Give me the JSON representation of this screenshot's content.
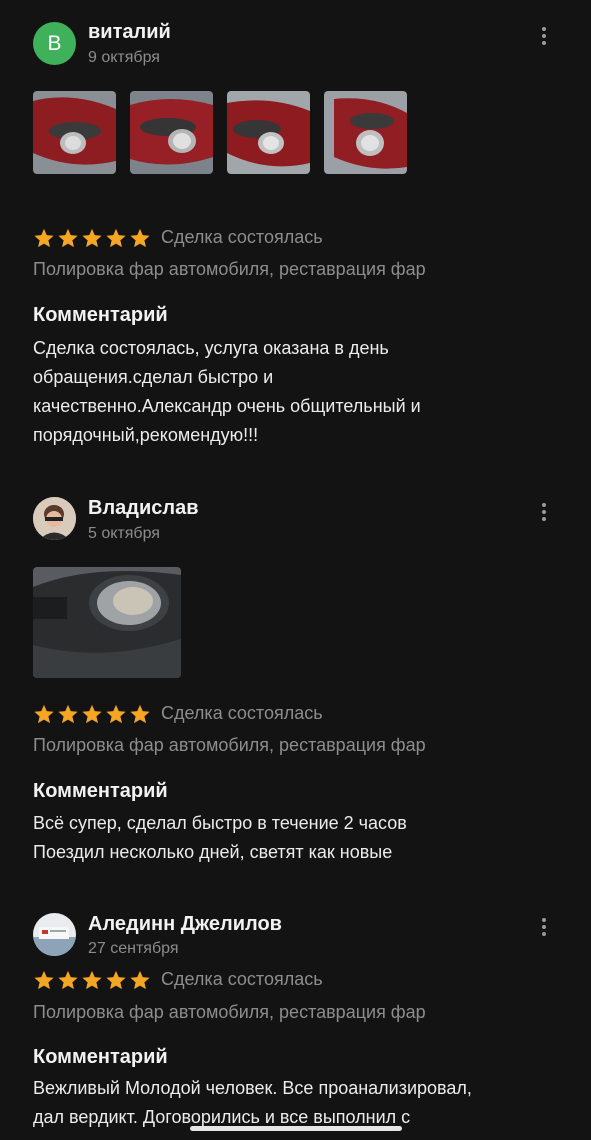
{
  "reviews": [
    {
      "avatar_letter": "В",
      "author": "виталий",
      "date": "9 октября",
      "status": "Сделка состоялась",
      "service": "Полировка фар автомобиля, реставрация фар",
      "comment_title": "Комментарий",
      "comment": "Сделка состоялась, услуга оказана в день\nобращения.сделал быстро и\nкачественно.Александр очень общительный и\nпорядочный,рекомендую!!!",
      "rating": 5,
      "photos": 4
    },
    {
      "author": "Владислав",
      "date": "5 октября",
      "status": "Сделка состоялась",
      "service": "Полировка фар автомобиля, реставрация фар",
      "comment_title": "Комментарий",
      "comment": "Всё супер, сделал быстро в течение 2 часов\nПоездил несколько дней, светят как новые",
      "rating": 5,
      "photos": 1
    },
    {
      "author": "Алединн Джелилов",
      "date": "27 сентября",
      "status": "Сделка состоялась",
      "service": "Полировка фар автомобиля, реставрация фар",
      "comment_title": "Комментарий",
      "comment": "Вежливый  Молодой человек. Все проанализировал,\nдал вердикт. Договорились и все выполнил с",
      "rating": 5,
      "photos": 0
    }
  ],
  "colors": {
    "background": "#131313",
    "star": "#f5a623",
    "avatar_letter_bg": "#3fb15a",
    "muted_text": "#8d8d8d"
  },
  "icons": {
    "menu": "more-vertical-icon",
    "star": "star-icon"
  }
}
